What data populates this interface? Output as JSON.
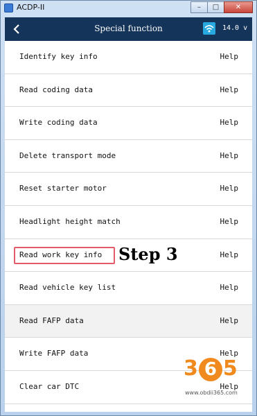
{
  "window": {
    "title": "ACDP-II",
    "minimize": "–",
    "maximize": "□",
    "close": "✕"
  },
  "header": {
    "title": "Special function",
    "voltage": "14.0 v",
    "back_icon": "back-arrow-icon",
    "wifi_icon": "wifi-icon"
  },
  "list": {
    "items": [
      {
        "label": "Identify key info",
        "help": "Help"
      },
      {
        "label": "Read coding data",
        "help": "Help"
      },
      {
        "label": "Write coding data",
        "help": "Help"
      },
      {
        "label": "Delete transport mode",
        "help": "Help"
      },
      {
        "label": "Reset starter motor",
        "help": "Help"
      },
      {
        "label": "Headlight height match",
        "help": "Help"
      },
      {
        "label": "Read work key info",
        "help": "Help"
      },
      {
        "label": "Read vehicle key list",
        "help": "Help"
      },
      {
        "label": "Read FAFP data",
        "help": "Help"
      },
      {
        "label": "Write FAFP data",
        "help": "Help"
      },
      {
        "label": "Clear car DTC",
        "help": "Help"
      }
    ]
  },
  "annotation": {
    "step": "Step 3",
    "color": "#e25b6a"
  },
  "watermark": {
    "digits": [
      "3",
      "6",
      "5"
    ],
    "url": "www.obdii365.com",
    "color": "#f08a1e"
  }
}
